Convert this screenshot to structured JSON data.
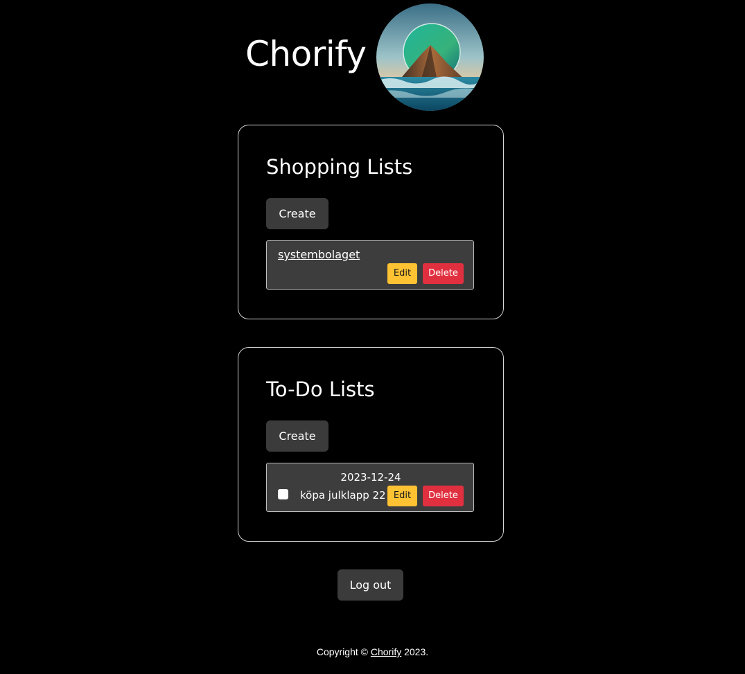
{
  "app": {
    "title": "Chorify",
    "logo_icon": "mountain-ocean-logo"
  },
  "shopping": {
    "title": "Shopping Lists",
    "create_label": "Create",
    "items": [
      {
        "name": "systembolaget",
        "edit_label": "Edit",
        "delete_label": "Delete"
      }
    ]
  },
  "todo": {
    "title": "To-Do Lists",
    "create_label": "Create",
    "items": [
      {
        "date": "2023-12-24",
        "text": "köpa julklapp 22",
        "checked": false,
        "edit_label": "Edit",
        "delete_label": "Delete"
      }
    ]
  },
  "logout_label": "Log out",
  "footer": {
    "prefix": "Copyright © ",
    "link": "Chorify",
    "suffix": " 2023."
  },
  "colors": {
    "background": "#000000",
    "button_dark": "#3b3b3b",
    "edit": "#ffc233",
    "delete": "#e0303f",
    "item_bg": "#3d3d3d"
  }
}
